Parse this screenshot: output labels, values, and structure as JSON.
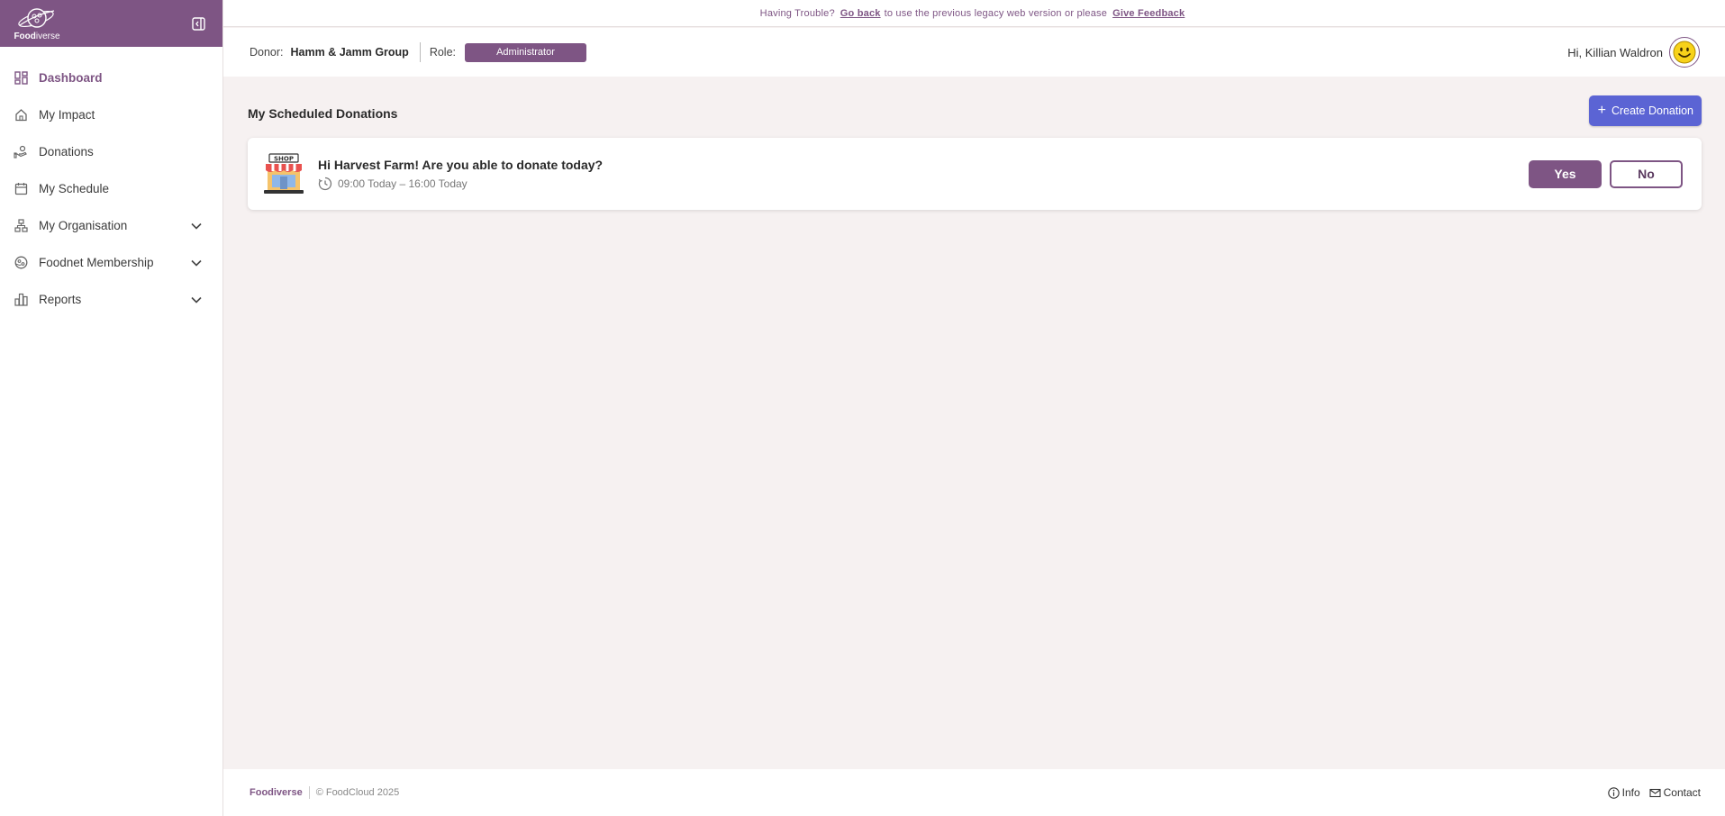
{
  "brand": {
    "logo_bold": "Food",
    "logo_rest": "iverse"
  },
  "nav": [
    {
      "label": "Dashboard",
      "icon": "dashboard-icon",
      "active": true
    },
    {
      "label": "My Impact",
      "icon": "home-icon"
    },
    {
      "label": "Donations",
      "icon": "hand-donation-icon"
    },
    {
      "label": "My Schedule",
      "icon": "calendar-icon"
    },
    {
      "label": "My Organisation",
      "icon": "org-chart-icon",
      "expandable": true
    },
    {
      "label": "Foodnet Membership",
      "icon": "network-icon",
      "expandable": true
    },
    {
      "label": "Reports",
      "icon": "bar-chart-icon",
      "expandable": true
    }
  ],
  "trouble": {
    "prefix": "Having Trouble?",
    "go_back": "Go back",
    "middle": "to use the previous legacy web version or please",
    "feedback": "Give Feedback"
  },
  "header": {
    "donor_label": "Donor:",
    "donor_name": "Hamm & Jamm Group",
    "role_label": "Role:",
    "role_value": "Administrator",
    "greeting": "Hi, Killian Waldron"
  },
  "main": {
    "section_title": "My Scheduled Donations",
    "create_button": "Create Donation",
    "card": {
      "question": "Hi Harvest Farm! Are you able to donate today?",
      "time": "09:00 Today – 16:00 Today",
      "yes": "Yes",
      "no": "No"
    }
  },
  "footer": {
    "brand": "Foodiverse",
    "copyright": "© FoodCloud 2025",
    "info": "Info",
    "contact": "Contact"
  },
  "colors": {
    "brand_purple": "#7e5584",
    "create_blue": "#5b64d4",
    "background": "#f6f1f1"
  }
}
